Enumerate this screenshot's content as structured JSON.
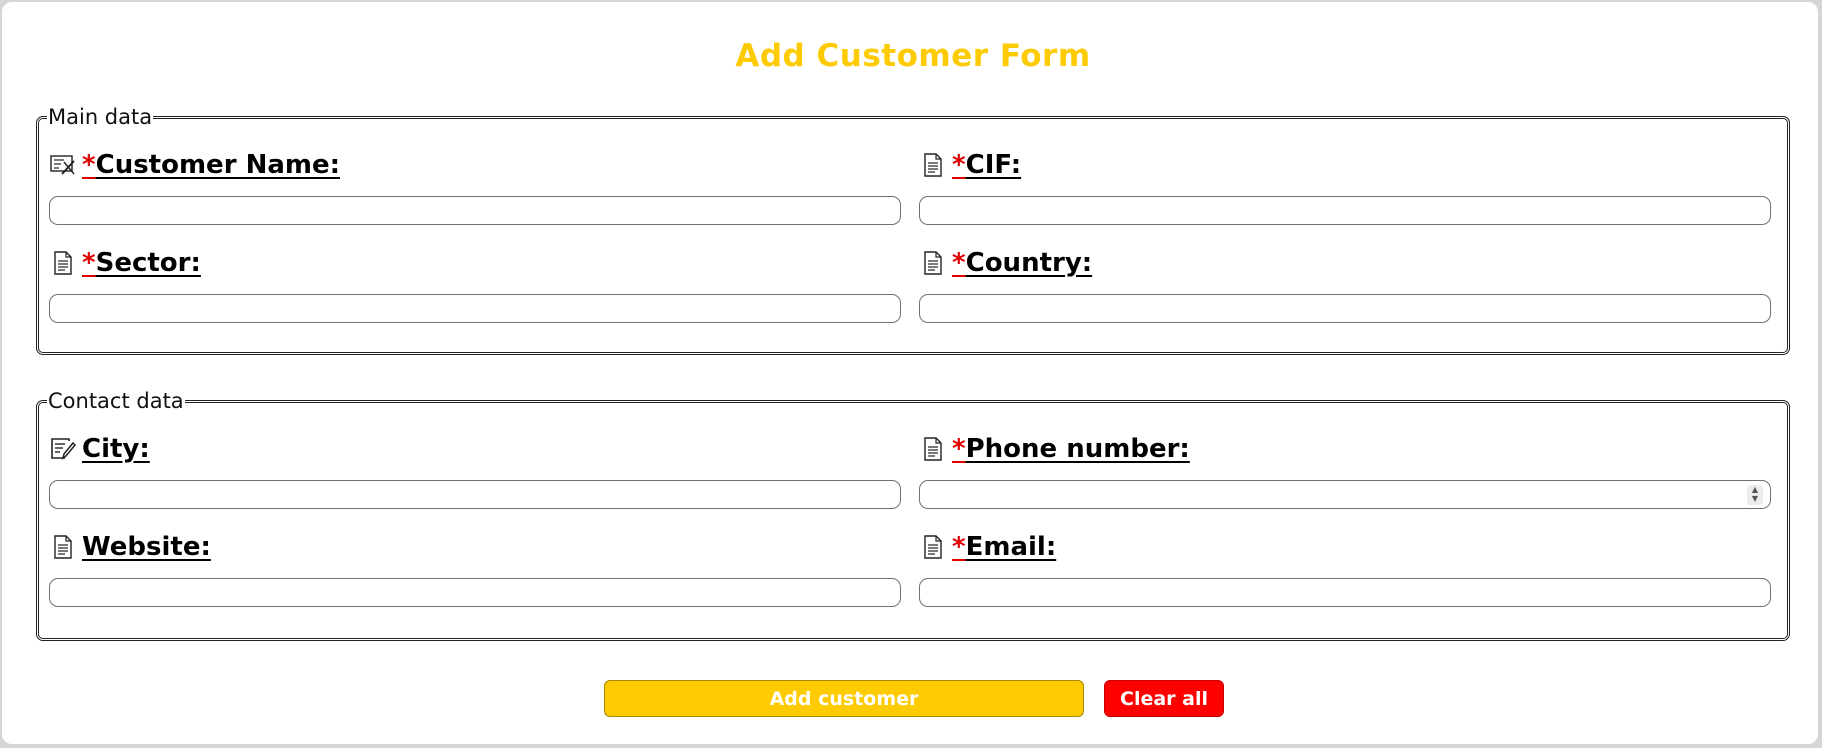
{
  "form": {
    "title": "Add Customer Form"
  },
  "sections": {
    "main": {
      "legend": "Main data",
      "fields": {
        "customer_name": {
          "required_mark": "*",
          "label": "Customer Name:",
          "icon": "form-edit-icon",
          "value": ""
        },
        "cif": {
          "required_mark": "*",
          "label": "CIF:",
          "icon": "document-icon",
          "value": ""
        },
        "sector": {
          "required_mark": "*",
          "label": "Sector:",
          "icon": "document-icon",
          "value": ""
        },
        "country": {
          "required_mark": "*",
          "label": "Country:",
          "icon": "document-icon",
          "value": ""
        }
      }
    },
    "contact": {
      "legend": "Contact data",
      "fields": {
        "city": {
          "label": "City:",
          "icon": "edit-note-icon",
          "value": ""
        },
        "phone": {
          "required_mark": "*",
          "label": "Phone number:",
          "icon": "document-icon",
          "value": ""
        },
        "website": {
          "label": "Website:",
          "icon": "document-icon",
          "value": ""
        },
        "email": {
          "required_mark": "*",
          "label": "Email:",
          "icon": "document-icon",
          "value": ""
        }
      }
    }
  },
  "actions": {
    "add_label": "Add customer",
    "clear_label": "Clear all"
  },
  "colors": {
    "accent": "#fecb00",
    "danger": "#ff0000",
    "required": "#e00000"
  }
}
